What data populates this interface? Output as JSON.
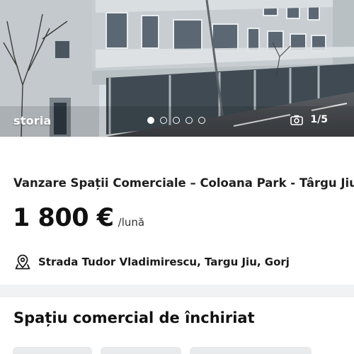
{
  "gallery": {
    "brand": "storia",
    "counter": "1/5",
    "dots_total": 5,
    "dots_active_index": 0,
    "icons": [
      "camera-icon"
    ]
  },
  "listing": {
    "title": "Vanzare Spații Comerciale – Coloana Park - Târgu Jiu",
    "price": "1 800 €",
    "price_unit": "/lună",
    "address": "Strada Tudor Vladimirescu, Targu Jiu, Gorj"
  },
  "section": {
    "title": "Spațiu comercial de închiriat"
  },
  "colors": {
    "text": "#1a1a1a",
    "divider": "#f1f2f4",
    "chip": "#e9eaec"
  }
}
